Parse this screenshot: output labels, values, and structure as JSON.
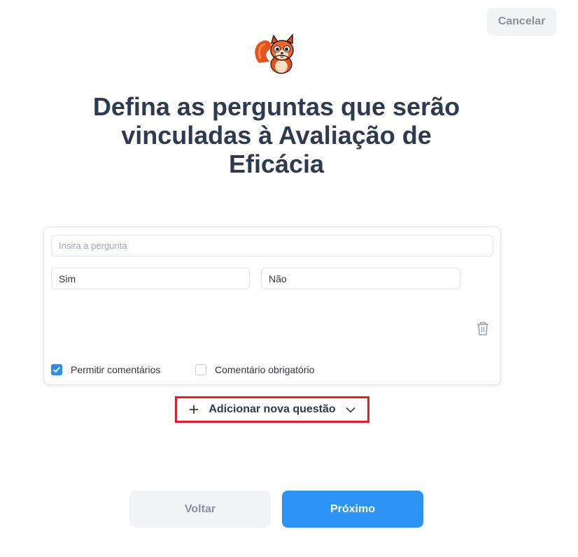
{
  "header": {
    "cancel_label": "Cancelar"
  },
  "logo": {
    "icon": "squirrel-mascot-icon"
  },
  "title": "Defina as perguntas que serão vinculadas à Avaliação de Eficácia",
  "question_card": {
    "question_placeholder": "Insira a pergunta",
    "question_value": "",
    "answers": [
      "Sim",
      "Não"
    ],
    "delete_icon": "trash-icon",
    "options": [
      {
        "label": "Permitir comentários",
        "checked": true
      },
      {
        "label": "Comentário obrigatório",
        "checked": false
      }
    ]
  },
  "add_question": {
    "label": "Adicionar nova questão",
    "icon_left": "plus-icon",
    "icon_right": "chevron-down-icon",
    "highlight_color": "#e11d2a"
  },
  "footer": {
    "back_label": "Voltar",
    "next_label": "Próximo"
  },
  "colors": {
    "primary": "#2b94f5",
    "checkbox": "#2b8df0",
    "title": "#2d3a4f",
    "muted_button_bg": "#f3f4f6"
  }
}
